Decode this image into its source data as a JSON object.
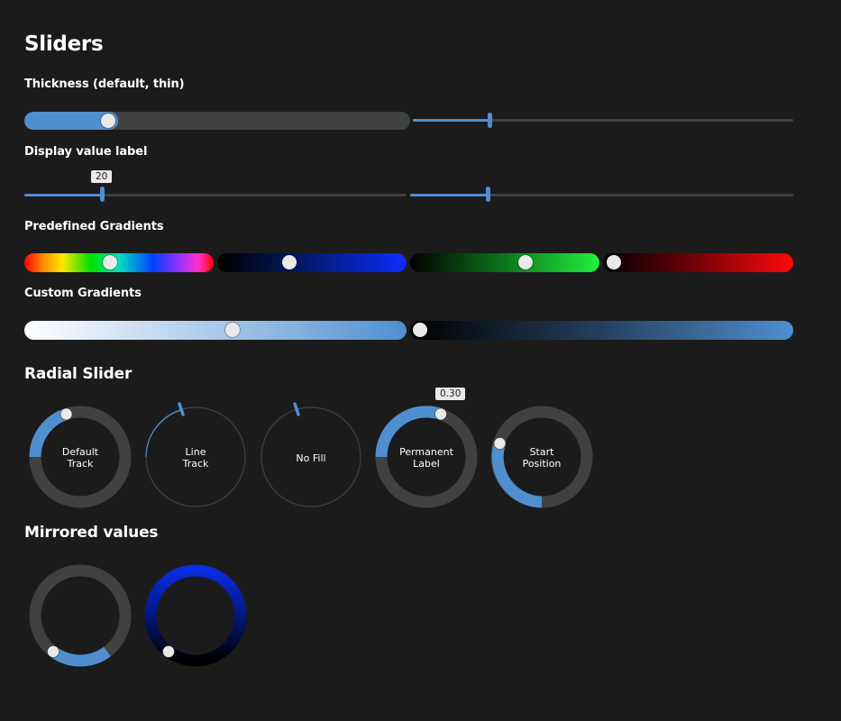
{
  "colors": {
    "background": "#1b1b1b",
    "accent": "#4f8fd0",
    "track": "#404242",
    "thumb": "#e9e9e9"
  },
  "headings": {
    "title": "Sliders",
    "thickness": "Thickness (default, thin)",
    "display_value": "Display value label",
    "predefined": "Predefined Gradients",
    "custom": "Custom Gradients",
    "radial": "Radial Slider",
    "mirrored": "Mirrored values"
  },
  "sliders": {
    "thick_default": {
      "value": 0.22
    },
    "thin": {
      "value": 0.2
    },
    "display_value": {
      "value": 0.2,
      "label": "20"
    },
    "display_value_right": {
      "value": 0.2
    },
    "gradient_rainbow": {
      "value": 0.45
    },
    "gradient_blue": {
      "value": 0.38
    },
    "gradient_green": {
      "value": 0.62
    },
    "gradient_red": {
      "value": 0.0
    },
    "custom_white_blue": {
      "value": 0.55
    },
    "custom_black_blue": {
      "value": 0.0
    }
  },
  "radial": [
    {
      "label": "Default\nTrack",
      "value": 0.25
    },
    {
      "label": "Line\nTrack",
      "value": 0.22
    },
    {
      "label": "No Fill",
      "value": 0.0
    },
    {
      "label": "Permanent\nLabel",
      "value": 0.3,
      "value_label": "0.30"
    },
    {
      "label": "Start\nPosition",
      "value": 0.3
    }
  ],
  "mirrored": [
    {
      "value": 0.35
    },
    {
      "value": 0.35
    }
  ]
}
